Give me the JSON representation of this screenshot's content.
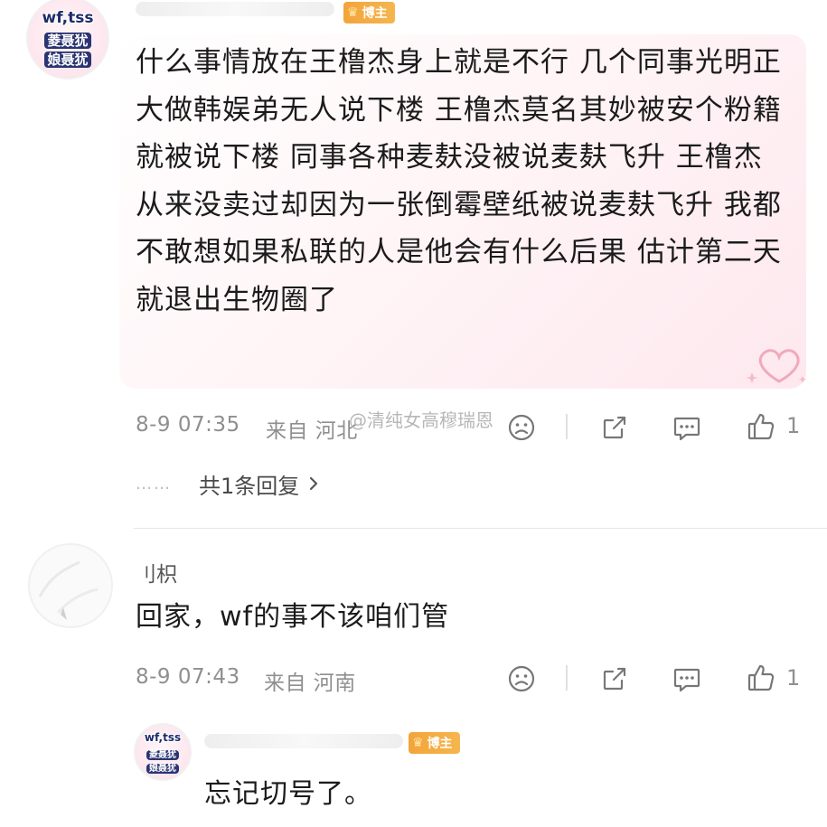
{
  "comment1": {
    "avatar_lines": [
      "wf,tss",
      "菱聂犹",
      "娘聂犹"
    ],
    "badge_label": "博主",
    "text": "什么事情放在王橹杰身上就是不行 几个同事光明正大做韩娱弟无人说下楼 王橹杰莫名其妙被安个粉籍就被说下楼 同事各种麦麸没被说麦麸飞升 王橹杰从来没卖过却因为一张倒霉壁纸被说麦麸飞升 我都不敢想如果私联的人是他会有什么后果 估计第二天就退出生物圈了",
    "time": "8-9 07:35",
    "location": "来自 河北",
    "like_count": "1",
    "replies_label": "共1条回复",
    "replies_dots": "……"
  },
  "watermark": "@清纯女高穆瑞恩",
  "comment2": {
    "username": "刂枳",
    "text": "回家，wf的事不该咱们管",
    "time": "8-9 07:43",
    "location": "来自 河南",
    "like_count": "1"
  },
  "reply": {
    "avatar_lines": [
      "wf,tss",
      "菱聂犹",
      "娘聂犹"
    ],
    "badge_label": "博主",
    "text": "忘记切号了。"
  },
  "icons": {
    "dislike": "sad-face-icon",
    "share": "share-icon",
    "comment": "comment-icon",
    "like": "thumbs-up-icon",
    "chevron": "chevron-right-icon",
    "crown": "crown-icon"
  },
  "colors": {
    "badge": "#f3a43b",
    "meta": "#8f8f8f",
    "bubble_tint": "#fde8ee"
  }
}
